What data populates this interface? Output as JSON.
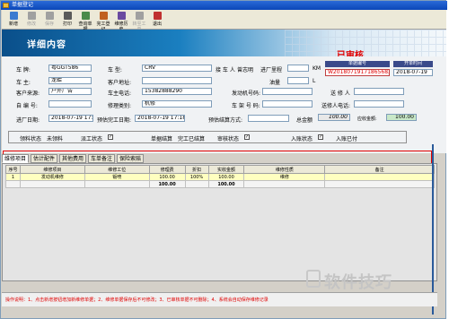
{
  "window": {
    "title": "单据登记"
  },
  "toolbar": {
    "items": [
      {
        "label": "新增",
        "icon": "new-icon",
        "color": "#3a7ad0",
        "enabled": true
      },
      {
        "label": "修改",
        "icon": "edit-icon",
        "color": "#a0a0a0",
        "enabled": false
      },
      {
        "label": "保存",
        "icon": "save-icon",
        "color": "#a0a0a0",
        "enabled": false
      },
      {
        "label": "打印",
        "icon": "print-icon",
        "color": "#5a5a5a",
        "enabled": true
      },
      {
        "label": "查询单据",
        "icon": "search-icon",
        "color": "#4a8a4a",
        "enabled": true
      },
      {
        "label": "完工登记",
        "icon": "complete-icon",
        "color": "#c06020",
        "enabled": true
      },
      {
        "label": "维修历史",
        "icon": "history-icon",
        "color": "#6a4aa0",
        "enabled": true
      },
      {
        "label": "转至工单",
        "icon": "transfer-icon",
        "color": "#a0a0a0",
        "enabled": false
      },
      {
        "label": "退出",
        "icon": "exit-icon",
        "color": "#c03030",
        "enabled": true
      }
    ]
  },
  "banner": {
    "title": "详细内容"
  },
  "status_stamp": "已审核",
  "order": {
    "no_label": "单据编号",
    "no": "W201807191718656830",
    "date_label": "开单时间",
    "date": "2018-07-19"
  },
  "form": {
    "plate_label": "车 牌:",
    "plate": "粤GGT586",
    "model_label": "车 型:",
    "model": "CRV",
    "sender_label": "接 车 人",
    "sender": "曾志明",
    "mileage_label": "进厂里程",
    "mileage_unit": "KM",
    "owner_label": "车 主:",
    "owner": "龙蛤",
    "address_label": "客户地址:",
    "fuel_label": "油量",
    "fuel_unit": "L",
    "source_label": "客户来源:",
    "source": "户外广告",
    "phone_label": "车主电话:",
    "phone": "15382888290",
    "engine_label": "发动机号码:",
    "repairer_label": "送 修 人",
    "car_label": "自 编 号:",
    "type_label": "修理类别:",
    "type": "机修",
    "frame_label": "车 架 号 码:",
    "repairer_phone_label": "送修人电话:",
    "in_date_label": "进厂日期:",
    "in_date": "2018-07-19 17:1",
    "eta_label": "预估完工日期:",
    "eta": "2018-07-19 17:18",
    "settle_label": "预估结算方式:",
    "total_label": "总金额",
    "total": "100.00",
    "discount_label": "应收金额:",
    "discount": "100.00"
  },
  "status": {
    "items": [
      {
        "label": "领料状态",
        "value": "未领料"
      },
      {
        "label": "派工状态",
        "checked": true
      },
      {
        "label": "单据结算",
        "value": "完工已结算"
      },
      {
        "label": "审核状态",
        "checked": true
      },
      {
        "label": "入账状态",
        "checked": true
      },
      {
        "label": "入账已付",
        "value": ""
      }
    ]
  },
  "tabs": [
    "维修项目",
    "估计配件",
    "其他费用",
    "车单备注",
    "保险索赔"
  ],
  "table": {
    "headers": [
      "序号",
      "维修项目",
      "维修工位",
      "修理费",
      "折扣",
      "实收金额",
      "维修性质",
      "备注"
    ],
    "rows": [
      [
        "1",
        "发动机维修",
        "钣喷",
        "100.00",
        "100%",
        "100.00",
        "维修",
        ""
      ]
    ],
    "totals": [
      "",
      "",
      "",
      "100.00",
      "",
      "100.00",
      "",
      ""
    ]
  },
  "bottom_hint": "操作说明：1、点击新增按钮增加新维修单据；2、维修单据保存后不可修改；3、已审核单据不可删除；4、系统会自动保存维修记录",
  "watermark": "软件技巧"
}
